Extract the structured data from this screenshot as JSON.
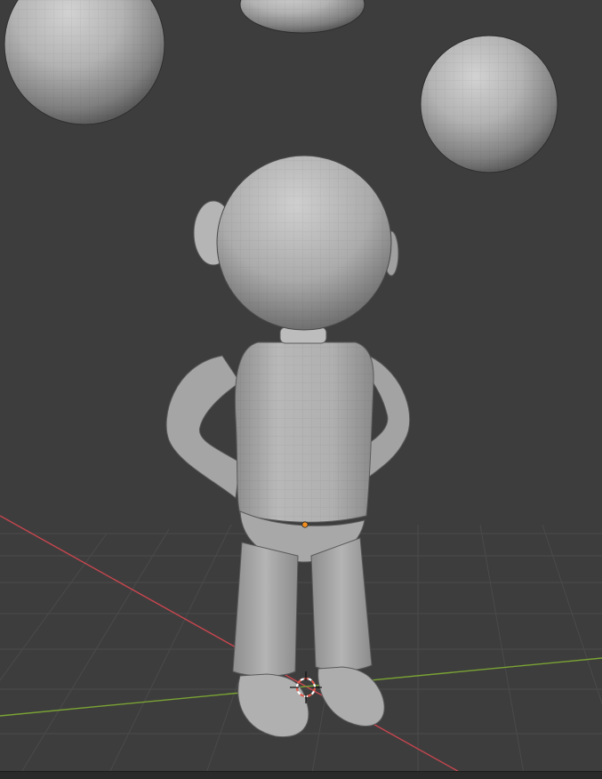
{
  "viewport": {
    "background": "#3d3d3d",
    "grid_line_color": "#4a4a4a",
    "x_axis_color": "#c8464f",
    "y_axis_color": "#7aa334",
    "mesh_color": "#a9a9a9",
    "origin_color": "#f08d1f",
    "cursor_colors": [
      "#e25c4f",
      "#ffffff"
    ]
  },
  "scene": {
    "objects": [
      "sphere",
      "sphere",
      "sphere",
      "character-body"
    ],
    "icons": [
      "3d-cursor-icon",
      "object-origin-icon"
    ]
  }
}
